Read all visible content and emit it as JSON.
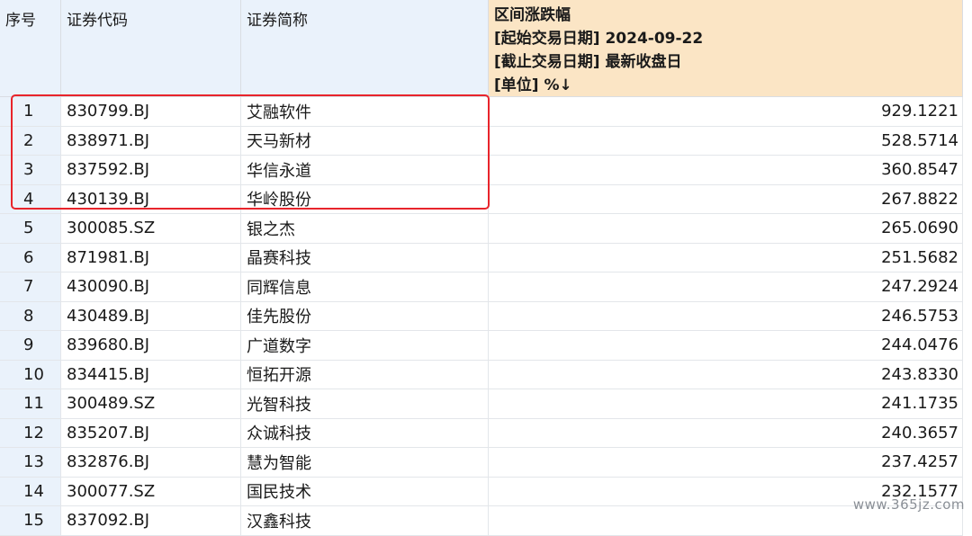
{
  "header": {
    "seq": "序号",
    "code": "证券代码",
    "name": "证券简称",
    "change_title": "区间涨跌幅",
    "start_date": "[起始交易日期] 2024-09-22",
    "end_date": "[截止交易日期] 最新收盘日",
    "unit": "[单位] %↓"
  },
  "rows": [
    {
      "seq": "1",
      "code": "830799.BJ",
      "name": "艾融软件",
      "change": "929.1221"
    },
    {
      "seq": "2",
      "code": "838971.BJ",
      "name": "天马新材",
      "change": "528.5714"
    },
    {
      "seq": "3",
      "code": "837592.BJ",
      "name": "华信永道",
      "change": "360.8547"
    },
    {
      "seq": "4",
      "code": "430139.BJ",
      "name": "华岭股份",
      "change": "267.8822"
    },
    {
      "seq": "5",
      "code": "300085.SZ",
      "name": "银之杰",
      "change": "265.0690"
    },
    {
      "seq": "6",
      "code": "871981.BJ",
      "name": "晶赛科技",
      "change": "251.5682"
    },
    {
      "seq": "7",
      "code": "430090.BJ",
      "name": "同辉信息",
      "change": "247.2924"
    },
    {
      "seq": "8",
      "code": "430489.BJ",
      "name": "佳先股份",
      "change": "246.5753"
    },
    {
      "seq": "9",
      "code": "839680.BJ",
      "name": "广道数字",
      "change": "244.0476"
    },
    {
      "seq": "10",
      "code": "834415.BJ",
      "name": "恒拓开源",
      "change": "243.8330"
    },
    {
      "seq": "11",
      "code": "300489.SZ",
      "name": "光智科技",
      "change": "241.1735"
    },
    {
      "seq": "12",
      "code": "835207.BJ",
      "name": "众诚科技",
      "change": "240.3657"
    },
    {
      "seq": "13",
      "code": "832876.BJ",
      "name": "慧为智能",
      "change": "237.4257"
    },
    {
      "seq": "14",
      "code": "300077.SZ",
      "name": "国民技术",
      "change": "232.1577"
    },
    {
      "seq": "15",
      "code": "837092.BJ",
      "name": "汉鑫科技",
      "change": ""
    }
  ],
  "watermark": "www.365jz.com",
  "colors": {
    "header_bg": "#eaf2fb",
    "change_header_bg": "#fbe5c5",
    "highlight_border": "#e8242b"
  }
}
